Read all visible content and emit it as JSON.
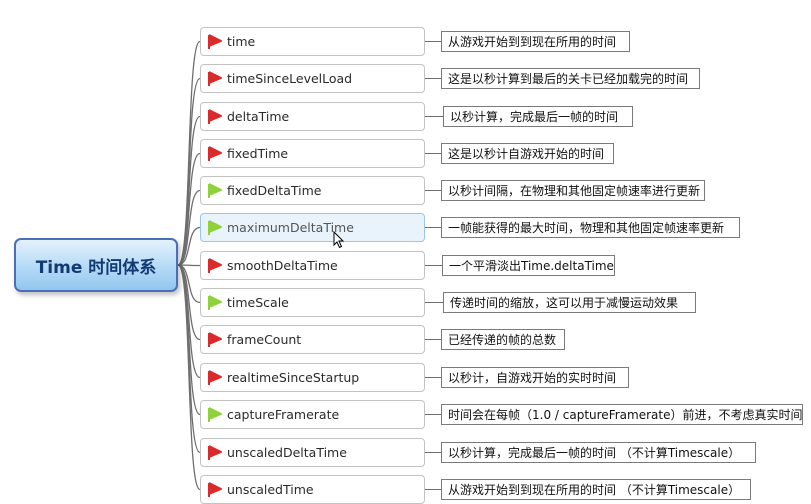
{
  "root": {
    "label": "Time 时间体系"
  },
  "flag_colors": {
    "red": "#d92b2b",
    "green": "#8fd13a"
  },
  "topics": [
    {
      "label": "time",
      "flag": "red",
      "note": "从游戏开始到到现在所用的时间"
    },
    {
      "label": "timeSinceLevelLoad",
      "flag": "red",
      "note": "这是以秒计算到最后的关卡已经加载完的时间"
    },
    {
      "label": "deltaTime",
      "flag": "red",
      "note": "以秒计算，完成最后一帧的时间"
    },
    {
      "label": "fixedTime",
      "flag": "red",
      "note": "这是以秒计自游戏开始的时间"
    },
    {
      "label": "fixedDeltaTime",
      "flag": "green",
      "note": "以秒计间隔，在物理和其他固定帧速率进行更新"
    },
    {
      "label": "maximumDeltaTime",
      "flag": "green",
      "note": "一帧能获得的最大时间，物理和其他固定帧速率更新",
      "selected": true
    },
    {
      "label": "smoothDeltaTime",
      "flag": "red",
      "note": "一个平滑淡出Time.deltaTime"
    },
    {
      "label": "timeScale",
      "flag": "green",
      "note": "传递时间的缩放，这可以用于减慢运动效果"
    },
    {
      "label": "frameCount",
      "flag": "red",
      "note": "已经传递的帧的总数"
    },
    {
      "label": "realtimeSinceStartup",
      "flag": "red",
      "note": "以秒计，自游戏开始的实时时间"
    },
    {
      "label": "captureFramerate",
      "flag": "green",
      "note": "时间会在每帧（1.0 / captureFramerate）前进，不考虑真实时间"
    },
    {
      "label": "unscaledDeltaTime",
      "flag": "red",
      "note": "以秒计算，完成最后一帧的时间 （不计算Timescale）"
    },
    {
      "label": "unscaledTime",
      "flag": "red",
      "note": "从游戏开始到到现在所用的时间 （不计算Timescale）"
    }
  ]
}
